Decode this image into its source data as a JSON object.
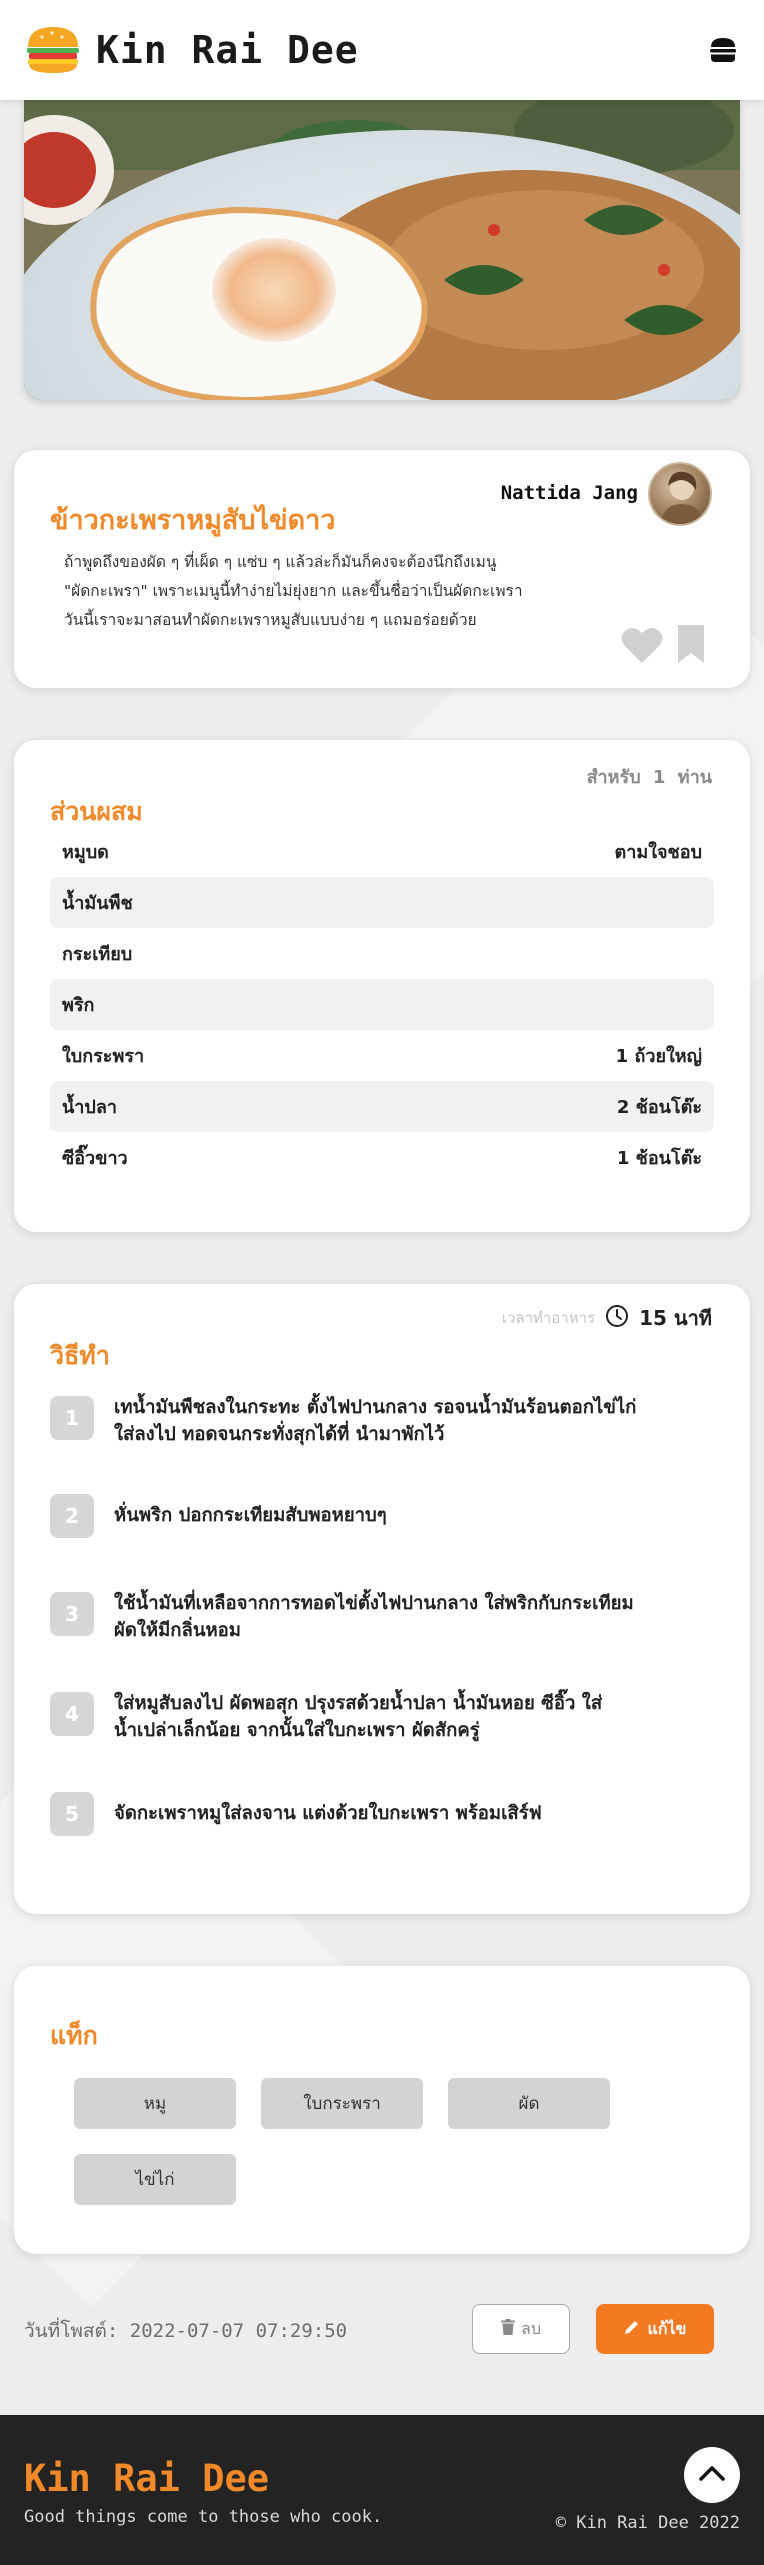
{
  "header": {
    "brand": "Kin Rai Dee",
    "logo_icon": "burger-icon",
    "menu_icon": "burger-menu-icon"
  },
  "recipe": {
    "title": "ข้าวกะเพราหมูสับไข่ดาว",
    "author": "Nattida Jang",
    "description_lines": [
      "ถ้าพูดถึงของผัด ๆ ที่เผ็ด ๆ แซ่บ ๆ แล้วล่ะก็มันก็คงจะต้องนึกถึงเมนู",
      "\"ผัดกะเพรา\" เพราะเมนูนี้ทำง่ายไม่ยุ่งยาก และขึ้นชื่อว่าเป็นผัดกะเพรา",
      "วันนี้เราจะมาสอนทำผัดกะเพราหมูสับแบบง่าย ๆ แถมอร่อยด้วย"
    ]
  },
  "ingredients": {
    "serving_label": "สำหรับ",
    "serving_count": "1",
    "serving_unit": "ท่าน",
    "title": "ส่วนผสม",
    "items": [
      {
        "name": "หมูบด",
        "amount": "ตามใจชอบ"
      },
      {
        "name": "น้ำมันพืช",
        "amount": ""
      },
      {
        "name": "กระเทียบ",
        "amount": ""
      },
      {
        "name": "พริก",
        "amount": ""
      },
      {
        "name": "ใบกระพรา",
        "amount": "1 ถ้วยใหญ่"
      },
      {
        "name": "น้ำปลา",
        "amount": "2 ช้อนโต๊ะ"
      },
      {
        "name": "ซีอิ๊วขาว",
        "amount": "1 ช้อนโต๊ะ"
      }
    ]
  },
  "method": {
    "title": "วิธีทำ",
    "cook_time_label": "เวลาทำอาหาร",
    "cook_time_value": "15 นาที",
    "steps": [
      {
        "num": "1",
        "lines": [
          "เทน้ำมันพืชลงในกระทะ ตั้งไฟปานกลาง รอจนน้ำมันร้อนตอกไข่ไก่",
          "ใส่ลงไป ทอดจนกระทั่งสุกได้ที่ นำมาพักไว้"
        ]
      },
      {
        "num": "2",
        "lines": [
          "หั่นพริก ปอกกระเทียมสับพอหยาบๆ"
        ]
      },
      {
        "num": "3",
        "lines": [
          "ใช้น้ำมันที่เหลือจากการทอดไข่ตั้งไฟปานกลาง ใส่พริกกับกระเทียม",
          "ผัดให้มีกลิ่นหอม"
        ]
      },
      {
        "num": "4",
        "lines": [
          "ใส่หมูสับลงไป ผัดพอสุก ปรุงรสด้วยน้ำปลา น้ำมันหอย ซีอิ๊ว ใส่",
          "น้ำเปล่าเล็กน้อย จากนั้นใส่ใบกะเพรา ผัดสักครู่"
        ]
      },
      {
        "num": "5",
        "lines": [
          "จัดกะเพราหมูใส่ลงจาน แต่งด้วยใบกะเพรา พร้อมเสิร์ฟ"
        ]
      }
    ]
  },
  "tags": {
    "title": "แท็ก",
    "items": [
      "หมู",
      "ใบกระพรา",
      "ผัด",
      "ไข่ไก่"
    ]
  },
  "post": {
    "date_label": "วันที่โพสต์:",
    "date_value": "2022-07-07 07:29:50",
    "delete_label": "ลบ",
    "edit_label": "แก้ไข"
  },
  "footer": {
    "brand": "Kin Rai Dee",
    "tagline": "Good things come to those who cook.",
    "copyright": "© Kin Rai Dee 2022"
  },
  "colors": {
    "accent": "#f0892a",
    "edit_button": "#f47a22",
    "footer_bg": "#232323"
  }
}
